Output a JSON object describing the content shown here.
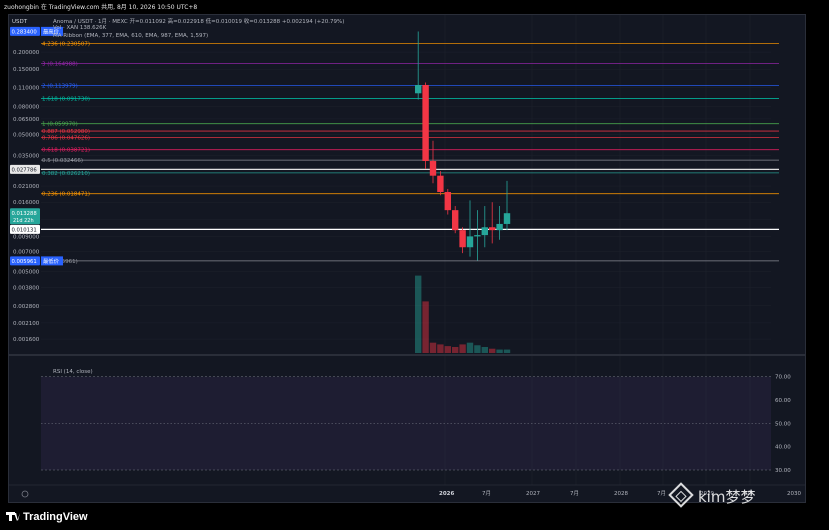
{
  "header_line": "zuohongbin 在 TradingView.com 共用, 8月 10, 2026 10:50 UTC+8",
  "quote_label": "USDT",
  "legend": {
    "symbol_line": "Anoma / USDT · 1月 · MEXC  开=0.011092 高=0.022918 低=0.010019 收=0.013288 +0.002194 (+20.79%)",
    "volume_line": "Vol · XAN  138.626K",
    "ribbon_line": "MA Ribbon (EMA, 377, EMA, 610, EMA, 987, EMA, 1,597)"
  },
  "price_tags": {
    "top": "0.283400",
    "top_suffix": "最高价",
    "low": "0.005961",
    "low_suffix": "最低价",
    "fib_line_price": "0.027786",
    "current_price": "0.013288",
    "current_countdown": "21d 22h",
    "white_line_price": "0.010131"
  },
  "axis_ticks": [
    "0.200000",
    "0.150000",
    "0.110000",
    "0.080000",
    "0.065000",
    "0.050000",
    "0.035000",
    "0.021000",
    "0.016000",
    "0.012000",
    "0.009000",
    "0.007000",
    "0.005000",
    "0.003800",
    "0.002800",
    "0.002100",
    "0.001600"
  ],
  "time_ticks": [
    "2026",
    "7月",
    "2027",
    "7月",
    "2028",
    "7月",
    "2029",
    "7月",
    "2030"
  ],
  "rsi": {
    "label": "RSI (14, close)",
    "ticks": [
      "70.00",
      "60.00",
      "50.00",
      "40.00",
      "30.00"
    ]
  },
  "footer": {
    "brand": "TradingView",
    "watermark": "kim梦梦"
  },
  "colors": {
    "up": "#26a69a",
    "down": "#f23645",
    "background": "#131722"
  },
  "chart_data": {
    "type": "candlestick",
    "title": "Anoma / USDT · 1月 · MEXC",
    "y_scale": "log",
    "fib_levels": [
      {
        "ratio": "4.236",
        "price": 0.230507,
        "label": "4.236 (0.230507)",
        "color": "#ff9800"
      },
      {
        "ratio": "3",
        "price": 0.164988,
        "label": "3 (0.164988)",
        "color": "#9c27b0"
      },
      {
        "ratio": "2",
        "price": 0.113979,
        "label": "2 (0.113979)",
        "color": "#2962ff"
      },
      {
        "ratio": "1.618",
        "price": 0.09173,
        "label": "1.618 (0.091730)",
        "color": "#00bfa5"
      },
      {
        "ratio": "1",
        "price": 0.05997,
        "label": "1 (0.059970)",
        "color": "#4caf50"
      },
      {
        "ratio": "0.887",
        "price": 0.05298,
        "label": "0.887 (0.052980)",
        "color": "#f23645"
      },
      {
        "ratio": "0.786",
        "price": 0.047626,
        "label": "0.786 (0.047626)",
        "color": "#f23645"
      },
      {
        "ratio": "0.618",
        "price": 0.038721,
        "label": "0.618 (0.038721)",
        "color": "#e91e63"
      },
      {
        "ratio": "0.5",
        "price": 0.032466,
        "label": "0.5 (0.032466)",
        "color": "#9598a1"
      },
      {
        "ratio": "0.382",
        "price": 0.02621,
        "label": "0.382 (0.026210)",
        "color": "#26a69a"
      },
      {
        "ratio": "0.236",
        "price": 0.018471,
        "label": "0.236 (0.018471)",
        "color": "#ff9800"
      },
      {
        "ratio": "0",
        "price": 0.005961,
        "label": "0 (0.005961)",
        "color": "#9598a1"
      }
    ],
    "candles": [
      {
        "o": 0.1,
        "h": 0.283,
        "l": 0.09,
        "c": 0.115
      },
      {
        "o": 0.115,
        "h": 0.12,
        "l": 0.028,
        "c": 0.032
      },
      {
        "o": 0.032,
        "h": 0.045,
        "l": 0.022,
        "c": 0.025
      },
      {
        "o": 0.025,
        "h": 0.027,
        "l": 0.018,
        "c": 0.019
      },
      {
        "o": 0.019,
        "h": 0.02,
        "l": 0.013,
        "c": 0.014
      },
      {
        "o": 0.014,
        "h": 0.015,
        "l": 0.0095,
        "c": 0.01
      },
      {
        "o": 0.01,
        "h": 0.0105,
        "l": 0.0068,
        "c": 0.0075
      },
      {
        "o": 0.0075,
        "h": 0.0165,
        "l": 0.0064,
        "c": 0.009
      },
      {
        "o": 0.009,
        "h": 0.014,
        "l": 0.006,
        "c": 0.0092
      },
      {
        "o": 0.0092,
        "h": 0.015,
        "l": 0.0075,
        "c": 0.0105
      },
      {
        "o": 0.0105,
        "h": 0.016,
        "l": 0.008,
        "c": 0.01
      },
      {
        "o": 0.01,
        "h": 0.015,
        "l": 0.0085,
        "c": 0.0111
      },
      {
        "o": 0.0111,
        "h": 0.0229,
        "l": 0.01,
        "c": 0.0133
      }
    ],
    "volumes": [
      0.9,
      0.6,
      0.12,
      0.1,
      0.08,
      0.07,
      0.1,
      0.12,
      0.09,
      0.07,
      0.05,
      0.04,
      0.04
    ]
  }
}
